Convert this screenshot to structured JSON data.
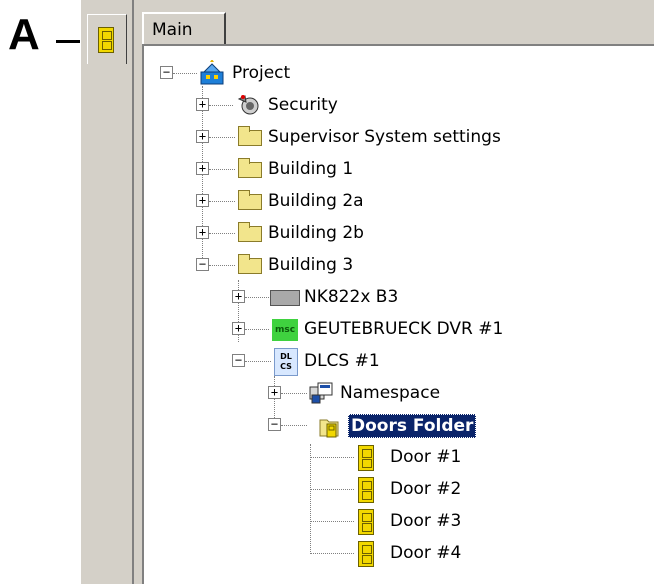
{
  "callout": {
    "letter": "A"
  },
  "tabs": {
    "main": "Main"
  },
  "tree": {
    "project": "Project",
    "security": "Security",
    "supervisor": "Supervisor System settings",
    "building1": "Building 1",
    "building2a": "Building 2a",
    "building2b": "Building 2b",
    "building3": "Building 3",
    "nk822": "NK822x B3",
    "geutebrueck": "GEUTEBRUECK DVR #1",
    "dlcs": "DLCS #1",
    "namespace": "Namespace",
    "doors_folder": "Doors Folder",
    "door1": "Door #1",
    "door2": "Door #2",
    "door3": "Door #3",
    "door4": "Door #4"
  },
  "icons": {
    "msc_text": "msc",
    "dlcs_text_1": "DL",
    "dlcs_text_2": "CS"
  },
  "colors": {
    "selection_bg": "#0a246a",
    "door_yellow": "#f2d800",
    "folder_yellow": "#f2e58c",
    "panel_gray": "#d4d0c8"
  }
}
